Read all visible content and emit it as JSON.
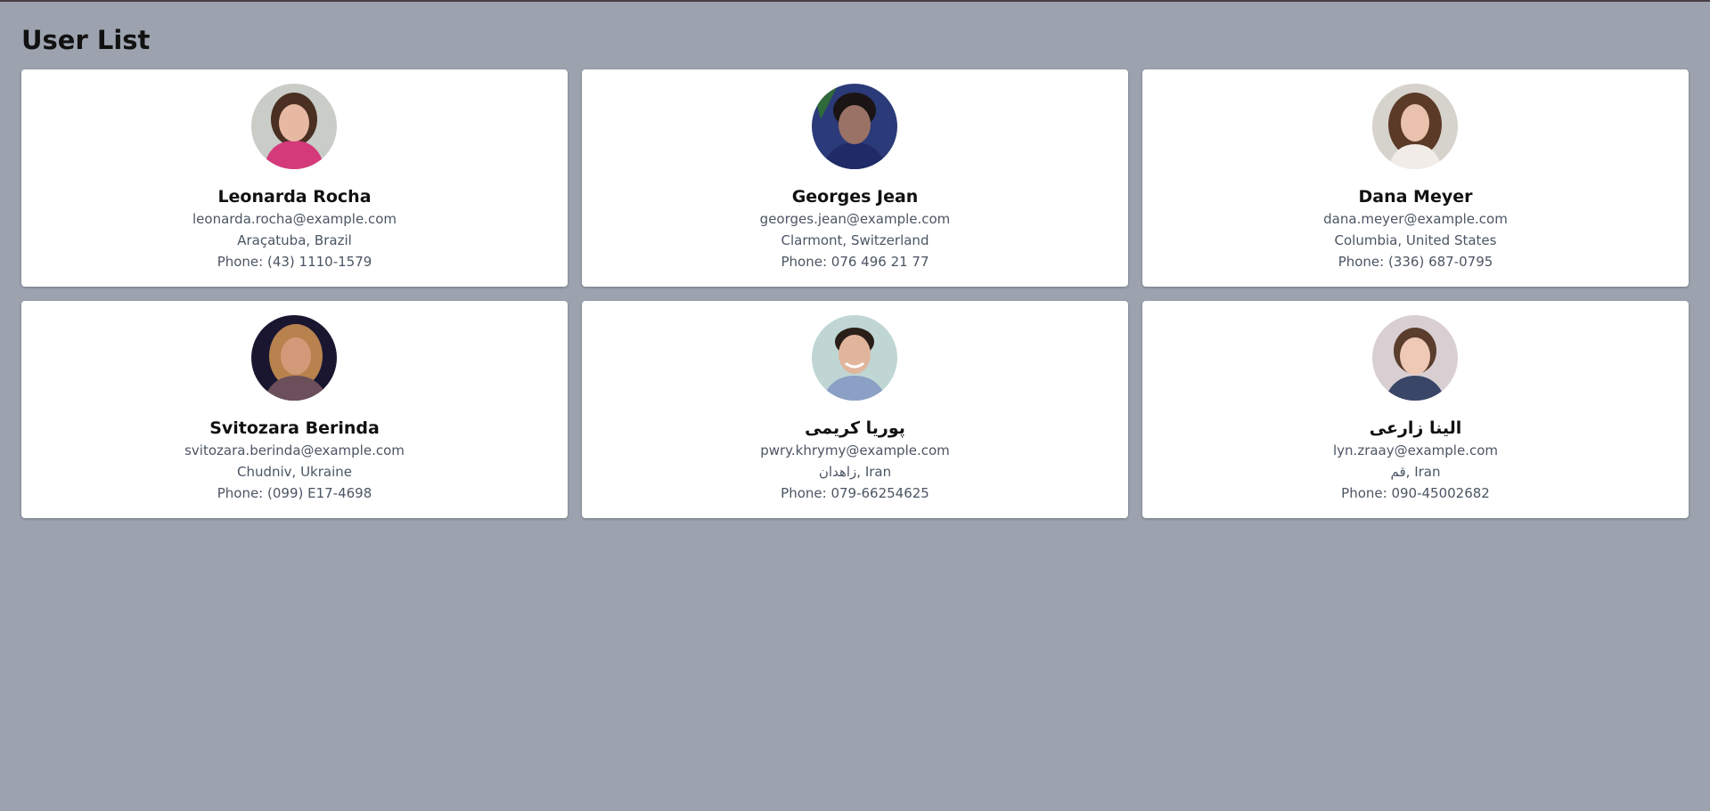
{
  "page": {
    "title": "User List",
    "background": "#9ca3af"
  },
  "users": [
    {
      "name": "Leonarda Rocha",
      "email": "leonarda.rocha@example.com",
      "location": "Araçatuba, Brazil",
      "phone": "Phone: (43) 1110-1579",
      "avatar_colors": {
        "bg": "#c9ccc7",
        "skin": "#e8b9a2",
        "hair": "#4a2f22",
        "shirt": "#d43a7a"
      }
    },
    {
      "name": "Georges Jean",
      "email": "georges.jean@example.com",
      "location": "Clarmont, Switzerland",
      "phone": "Phone: 076 496 21 77",
      "avatar_colors": {
        "bg": "#2b3a78",
        "skin": "#9a7266",
        "hair": "#1a1414",
        "shirt": "#1f2a66"
      }
    },
    {
      "name": "Dana Meyer",
      "email": "dana.meyer@example.com",
      "location": "Columbia, United States",
      "phone": "Phone: (336) 687-0795",
      "avatar_colors": {
        "bg": "#d6d2cc",
        "skin": "#eac1ad",
        "hair": "#5b3a27",
        "shirt": "#f1ece8"
      }
    },
    {
      "name": "Svitozara Berinda",
      "email": "svitozara.berinda@example.com",
      "location": "Chudniv, Ukraine",
      "phone": "Phone: (099) E17-4698",
      "avatar_colors": {
        "bg": "#1a1630",
        "skin": "#d29a78",
        "hair": "#b8824e",
        "shirt": "#6b4f5a"
      }
    },
    {
      "name": "پوریا کریمی",
      "email": "pwry.khrymy@example.com",
      "location": "زاهدان, Iran",
      "phone": "Phone: 079-66254625",
      "avatar_colors": {
        "bg": "#bfd6d4",
        "skin": "#e1b59b",
        "hair": "#2a1e18",
        "shirt": "#8aa0c4"
      }
    },
    {
      "name": "الینا زارعی",
      "email": "lyn.zraay@example.com",
      "location": "قم, Iran",
      "phone": "Phone: 090-45002682",
      "avatar_colors": {
        "bg": "#d9cfd3",
        "skin": "#efc9b6",
        "hair": "#5a3d2c",
        "shirt": "#3a4668"
      }
    }
  ]
}
